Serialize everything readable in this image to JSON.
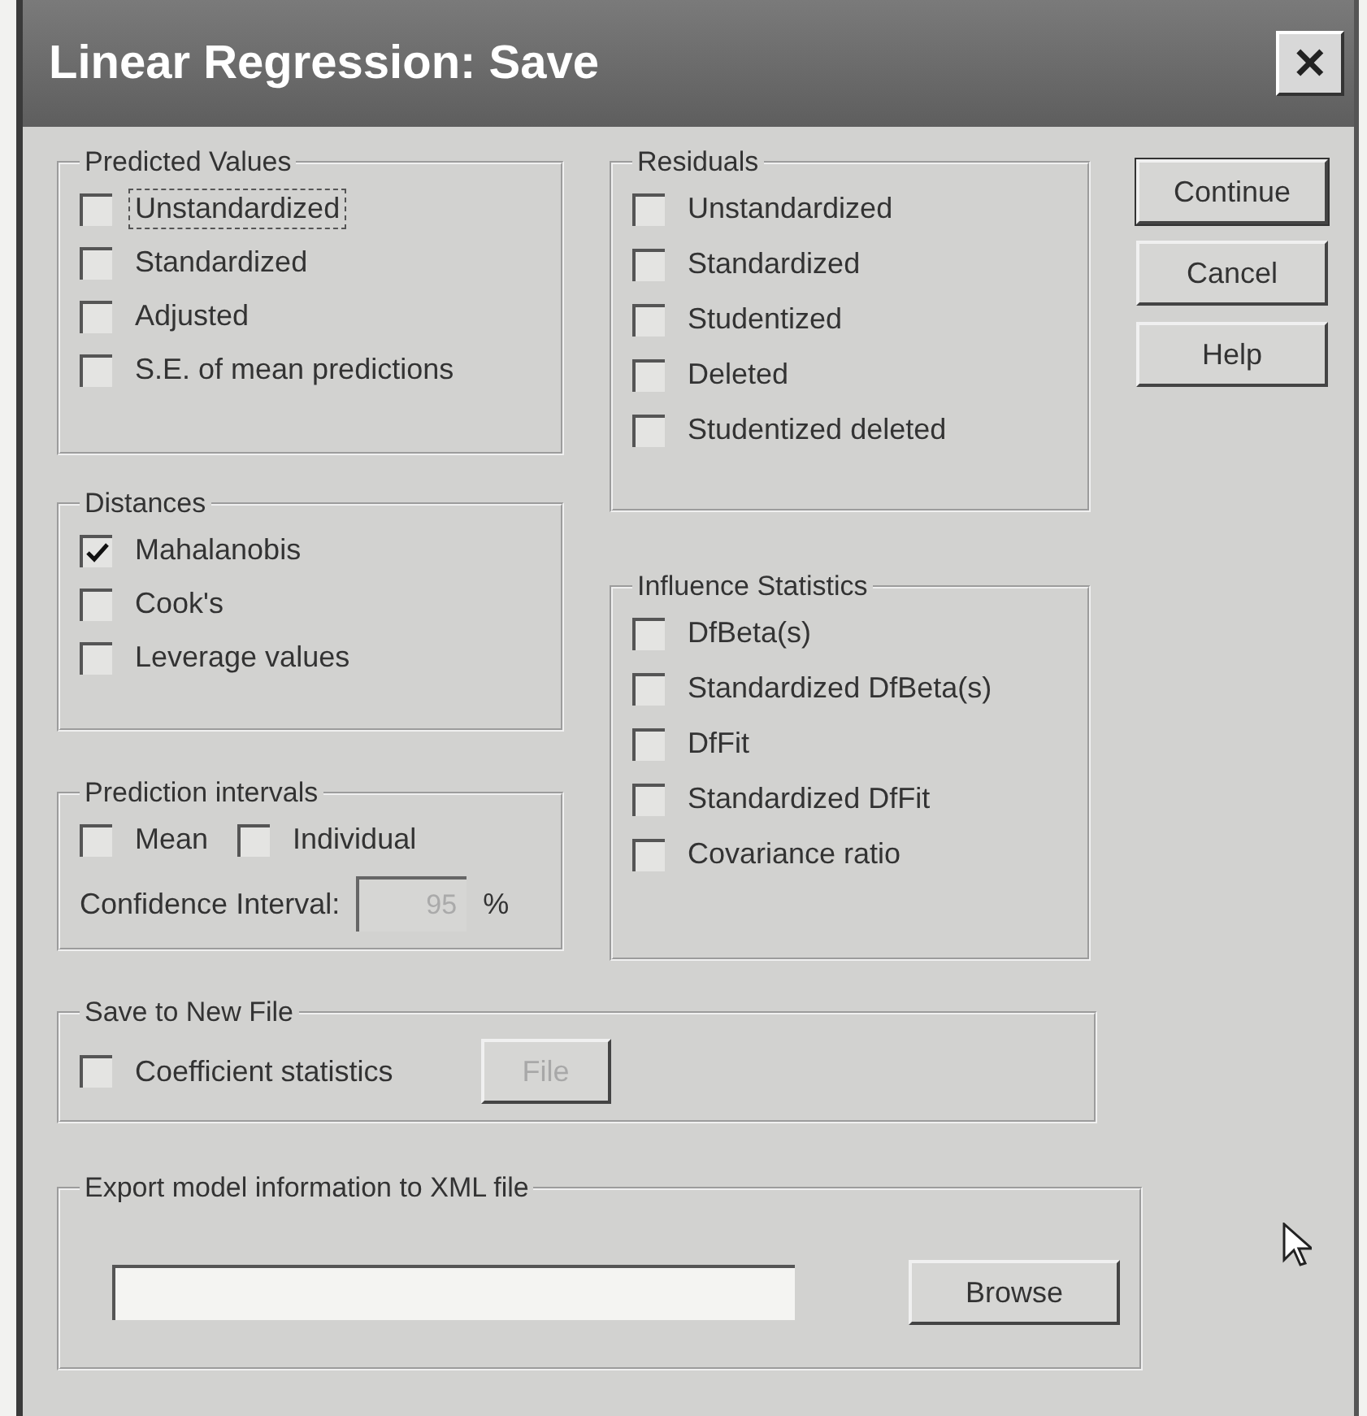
{
  "window": {
    "title": "Linear Regression: Save",
    "close": "✕"
  },
  "predicted_values": {
    "title": "Predicted Values",
    "items": [
      {
        "label": "Unstandardized",
        "checked": false,
        "focused": true
      },
      {
        "label": "Standardized",
        "checked": false,
        "focused": false
      },
      {
        "label": "Adjusted",
        "checked": false,
        "focused": false
      },
      {
        "label": "S.E. of mean predictions",
        "checked": false,
        "focused": false
      }
    ]
  },
  "distances": {
    "title": "Distances",
    "items": [
      {
        "label": "Mahalanobis",
        "checked": true
      },
      {
        "label": "Cook's",
        "checked": false
      },
      {
        "label": "Leverage values",
        "checked": false
      }
    ]
  },
  "prediction_intervals": {
    "title": "Prediction intervals",
    "items": [
      {
        "label": "Mean",
        "checked": false
      },
      {
        "label": "Individual",
        "checked": false
      }
    ],
    "confidence": {
      "label": "Confidence Interval:",
      "value": "95",
      "unit": "%",
      "disabled": true
    }
  },
  "residuals": {
    "title": "Residuals",
    "items": [
      {
        "label": "Unstandardized",
        "checked": false
      },
      {
        "label": "Standardized",
        "checked": false
      },
      {
        "label": "Studentized",
        "checked": false
      },
      {
        "label": "Deleted",
        "checked": false
      },
      {
        "label": "Studentized deleted",
        "checked": false
      }
    ]
  },
  "influence_statistics": {
    "title": "Influence Statistics",
    "items": [
      {
        "label": "DfBeta(s)",
        "checked": false
      },
      {
        "label": "Standardized DfBeta(s)",
        "checked": false
      },
      {
        "label": "DfFit",
        "checked": false
      },
      {
        "label": "Standardized DfFit",
        "checked": false
      },
      {
        "label": "Covariance ratio",
        "checked": false
      }
    ]
  },
  "buttons": [
    {
      "label": "Continue",
      "default": true
    },
    {
      "label": "Cancel",
      "default": false
    },
    {
      "label": "Help",
      "default": false
    }
  ],
  "save_to_new_file": {
    "title": "Save to New File",
    "item": {
      "label": "Coefficient statistics",
      "checked": false
    },
    "file_button": {
      "label": "File",
      "disabled": true
    }
  },
  "export_xml": {
    "title": "Export model information to XML file",
    "button": "Browse"
  }
}
